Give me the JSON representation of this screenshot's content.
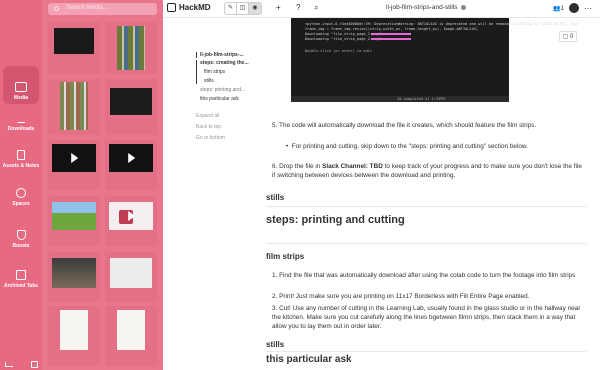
{
  "rail": {
    "items": [
      {
        "label": "Media",
        "active": true
      },
      {
        "label": "Downloads"
      },
      {
        "label": "Assets & Notes"
      },
      {
        "label": "Spaces"
      },
      {
        "label": "Boosts"
      },
      {
        "label": "Archived Tabs"
      }
    ]
  },
  "media": {
    "search_placeholder": "Search Media..."
  },
  "topbar": {
    "app_name": "HackMD",
    "doc_title": "ll-job-film-strips-and-stills",
    "user_count": "1"
  },
  "toc": {
    "title": "ll-job-film-strips-...",
    "items": [
      "steps: creating the...",
      "film strips",
      "stills",
      "steps: printing and...",
      "this particular ask"
    ],
    "links": [
      "Expand all",
      "Back to top",
      "Go to bottom"
    ]
  },
  "comments": {
    "count": "0"
  },
  "terminal": {
    "lines": [
      "<python-input-0-f4e4400000>:59: DeprecationWarning: ANTIALIAS is deprecated and will be removed in Pillow 10 (2023-07-01). Use",
      "  frame_img = frame_img.resize((strip_width_px, frame_height_px), Image.ANTIALIAS)",
      "Downloading \"film_strip_page_1.png\"",
      "Downloading \"film_strip_page_2.png\"",
      "Double-click (or enter) to edit"
    ],
    "status": "3m   completed at 1:33PM"
  },
  "doc": {
    "step5": "5.   The code will automatically download the file it creates, which should feature the film strips.",
    "step5_bullet": "For printing and cutting, skip down to the \"steps: printing and cutting\" section below.",
    "step6_pre": "6.   Drop the file in ",
    "step6_bold": "Slack Channel: TBD",
    "step6_post": " to keep track of your progress and to make sure you don't lose the file if switching between devices between the download and printing.",
    "stills_h": "stills",
    "printing_h": "steps: printing and cutting",
    "filmstrips_h": "film strips",
    "p1": "1.   Find the file that was automatically download after using the colab code to turn the footage into film strips",
    "p2": "2.   Print! Just make sure you are printing on 11x17 Borderless with Fill Entire Page enabled.",
    "p3": "3.   Cut! Use any number of cutting in the Learning Lab, usually found in the glass studio or in the hallway near the kitchen. Make sure you cut carefully along the lines bgetween filmn strips, then stack them in a way that allow you to lay them out in order later.",
    "stills2_h": "stills",
    "ask_h": "this particular ask"
  },
  "colors": {
    "rail": "#e86a82",
    "panel": "#e9768d",
    "accent": "#d35670"
  }
}
